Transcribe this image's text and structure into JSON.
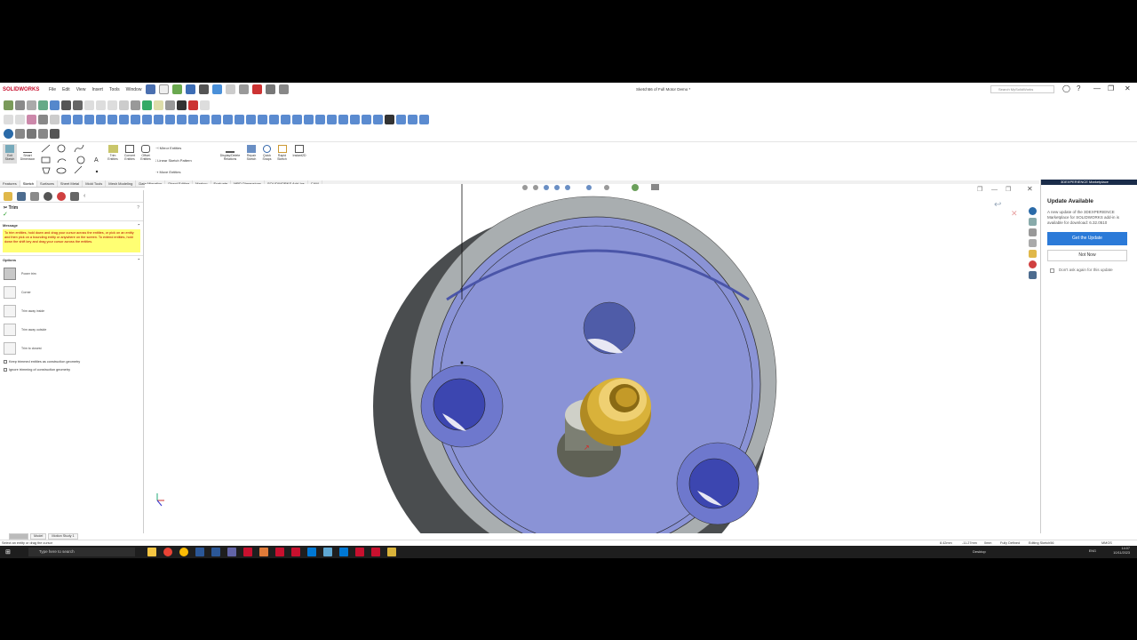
{
  "app": {
    "logo_text": "SOLIDWORKS",
    "menu": [
      "File",
      "Edit",
      "View",
      "Insert",
      "Tools",
      "Window"
    ],
    "document_title": "Sketch56 of Full Motor Demo *",
    "search_placeholder": "Search MySolidWorks"
  },
  "ribbon": {
    "exit_sketch": "Exit Sketch",
    "smart_dimension": "Smart Dimension",
    "trim_entities": "Trim Entities",
    "convert_entities": "Convert Entities",
    "offset_entities": "Offset Entities",
    "mirror_entities": "Mirror Entities",
    "linear_sketch_pattern": "Linear Sketch Pattern",
    "move_entities": "Move Entities",
    "display_delete_relations": "Display/Delete Relations",
    "repair_sketch": "Repair Sketch",
    "quick_snaps": "Quick Snaps",
    "rapid_sketch": "Rapid Sketch",
    "instant2d": "Instant2D"
  },
  "tabs": [
    "Features",
    "Sketch",
    "Surfaces",
    "Sheet Metal",
    "Mold Tools",
    "Mesh Modeling",
    "Data Migration",
    "Direct Editing",
    "Markup",
    "Evaluate",
    "MBD Dimensions",
    "SOLIDWORKS Add-Ins",
    "CAM"
  ],
  "active_tab": "Sketch",
  "property_manager": {
    "title": "Trim",
    "message_header": "Message",
    "message": "To trim entities, hold down and drag your cursor across the entities, or pick on an entity and then pick on a bounding entity or anywhere on the screen. To extend entities, hold down the shift key and drag your cursor across the entities.",
    "options_header": "Options",
    "options": [
      "Power trim",
      "Corner",
      "Trim away inside",
      "Trim away outside",
      "Trim to closest"
    ],
    "checkboxes": [
      "Keep trimmed entities as construction geometry",
      "Ignore trimming of construction geometry"
    ]
  },
  "marketplace": {
    "header": "3DEXPERIENCE Marketplace",
    "title": "Update Available",
    "text": "A new update of the 3DEXPERIENCE Marketplace for SOLIDWORKS add-in is available for download: 6.32.0510",
    "primary_button": "Get the Update",
    "secondary_button": "Not Now",
    "checkbox_label": "Don't ask again for this update"
  },
  "bottom_tabs": [
    "Model",
    "Motion Study 1"
  ],
  "status": {
    "hint": "Select an entity or drag the cursor",
    "x": "8.42mm",
    "y": "-11.27mm",
    "z": "0mm",
    "state": "Fully Defined",
    "editing": "Editing Sketch56",
    "units": "MMGS"
  },
  "taskbar": {
    "search_placeholder": "Type here to search",
    "desktop": "Desktop",
    "lang": "ENG",
    "time": "14:07",
    "date": "10/11/2023"
  },
  "colors": {
    "face_blue": "#8a93d6",
    "rim_grey": "#a9aeb0",
    "brass": "#d9b23a",
    "accent_blue": "#2b7ad8"
  }
}
